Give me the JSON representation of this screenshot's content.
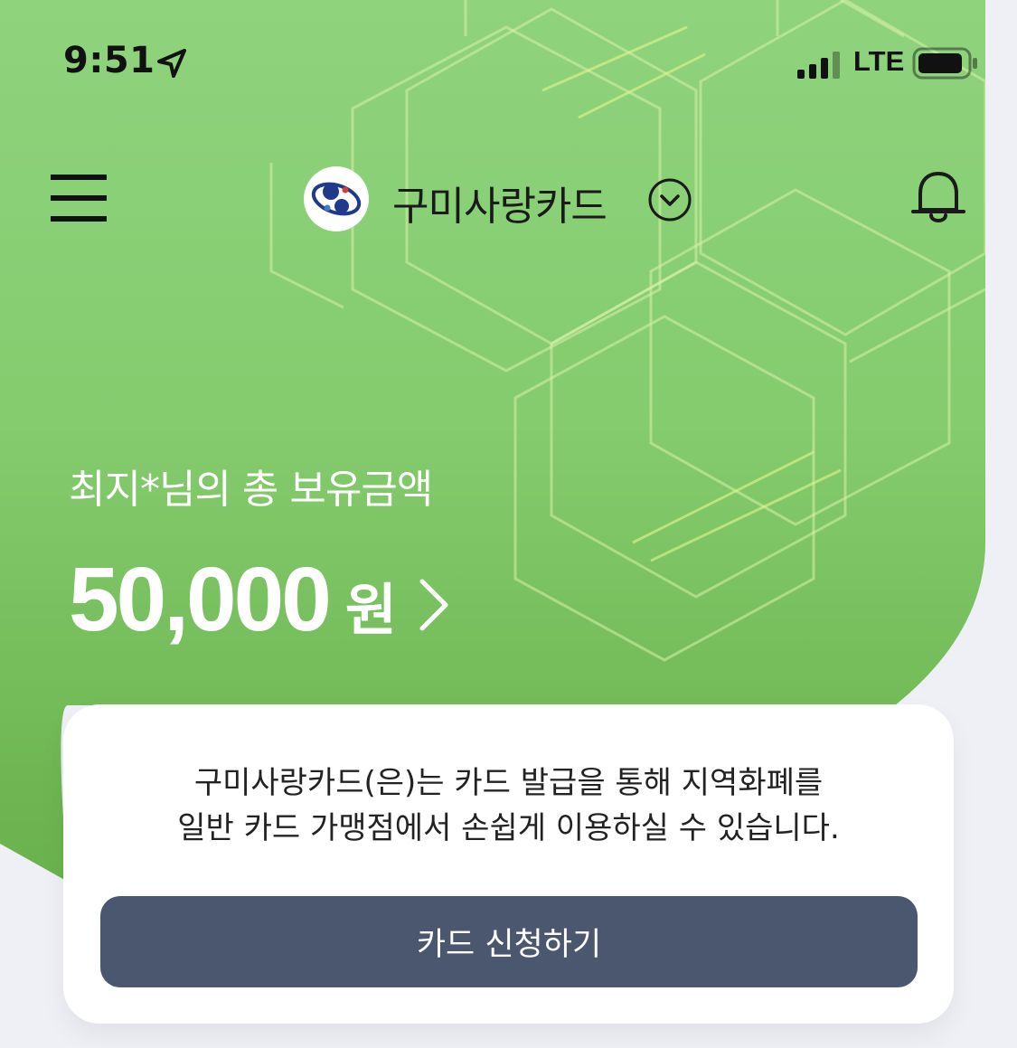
{
  "status_bar": {
    "time": "9:51",
    "network": "LTE",
    "icons": [
      "location-arrow-icon",
      "signal-bars-icon",
      "battery-icon"
    ]
  },
  "header": {
    "brand_name": "구미사랑카드",
    "icons": [
      "menu-icon",
      "brand-logo",
      "chevron-down-icon",
      "bell-icon"
    ]
  },
  "balance": {
    "greeting": "최지*님의 총 보유금액",
    "amount": "50,000",
    "unit": "원"
  },
  "card_panel": {
    "description_line1": "구미사랑카드(은)는 카드 발급을 통해 지역화폐를",
    "description_line2": "일반 카드 가맹점에서 손쉽게 이용하실 수 있습니다.",
    "apply_button_label": "카드 신청하기"
  },
  "colors": {
    "hero_green": "#84cc6e",
    "button_slate": "#4b566f",
    "page_background": "#eef0f5",
    "logo_navy": "#1f3a8a"
  }
}
